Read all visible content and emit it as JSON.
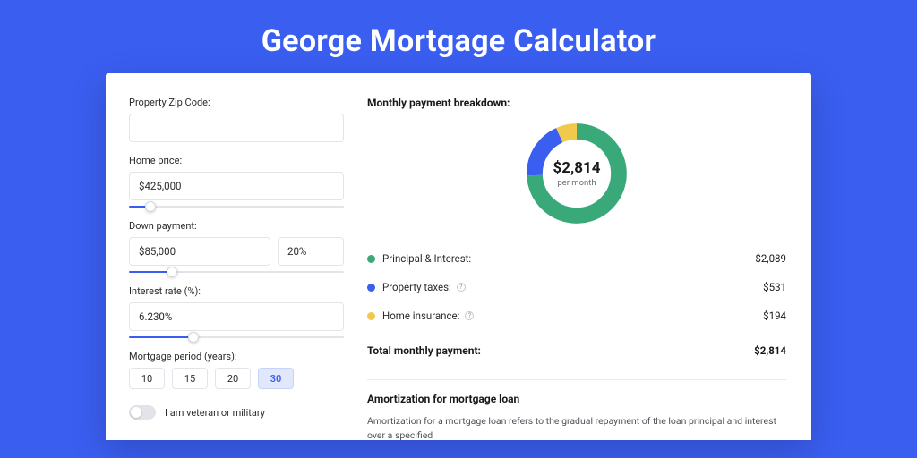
{
  "page": {
    "title": "George Mortgage Calculator"
  },
  "form": {
    "zip": {
      "label": "Property Zip Code:",
      "value": ""
    },
    "home_price": {
      "label": "Home price:",
      "value": "$425,000",
      "slider_pct": 10
    },
    "down_payment": {
      "label": "Down payment:",
      "amount": "$85,000",
      "pct": "20%",
      "slider_pct": 20
    },
    "interest_rate": {
      "label": "Interest rate (%):",
      "value": "6.230%",
      "slider_pct": 30
    },
    "mortgage_period": {
      "label": "Mortgage period (years):",
      "options": [
        "10",
        "15",
        "20",
        "30"
      ],
      "selected": "30"
    },
    "veteran": {
      "label": "I am veteran or military",
      "value": false
    }
  },
  "breakdown": {
    "title": "Monthly payment breakdown:",
    "center_amount": "$2,814",
    "center_sub": "per month",
    "items": [
      {
        "key": "pi",
        "label": "Principal & Interest:",
        "value": "$2,089",
        "dot": "green",
        "info": false
      },
      {
        "key": "tax",
        "label": "Property taxes:",
        "value": "$531",
        "dot": "blue",
        "info": true
      },
      {
        "key": "ins",
        "label": "Home insurance:",
        "value": "$194",
        "dot": "yellow",
        "info": true
      }
    ],
    "total_label": "Total monthly payment:",
    "total_value": "$2,814"
  },
  "amortization": {
    "title": "Amortization for mortgage loan",
    "text": "Amortization for a mortgage loan refers to the gradual repayment of the loan principal and interest over a specified"
  },
  "colors": {
    "accent": "#3A5EF0",
    "green": "#39A97A",
    "blue": "#3A5EF0",
    "yellow": "#F1C94B"
  },
  "chart_data": {
    "type": "pie",
    "title": "Monthly payment breakdown",
    "unit": "USD per month",
    "categories": [
      "Principal & Interest",
      "Property taxes",
      "Home insurance"
    ],
    "values": [
      2089,
      531,
      194
    ],
    "colors": [
      "#39A97A",
      "#3A5EF0",
      "#F1C94B"
    ],
    "total": 2814,
    "center_label": "$2,814 per month"
  }
}
